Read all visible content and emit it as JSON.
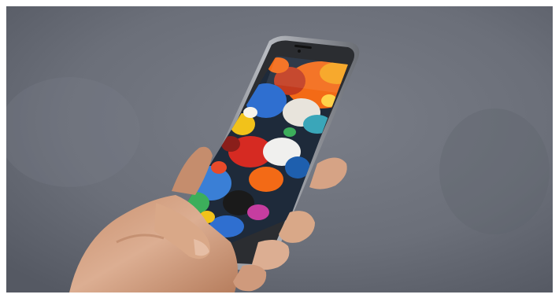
{
  "photo": {
    "subject": "hand-holding-smartphone",
    "colors": {
      "background": "#6f737d",
      "phone_body": "#2b2d31",
      "phone_rim": "#9a9da3",
      "skin": "#d9a888",
      "paint_orange": "#f36a16",
      "paint_blue": "#2f6fd0",
      "paint_red": "#d62a22",
      "paint_yellow": "#f2c21a",
      "paint_green": "#3cae5b"
    }
  }
}
